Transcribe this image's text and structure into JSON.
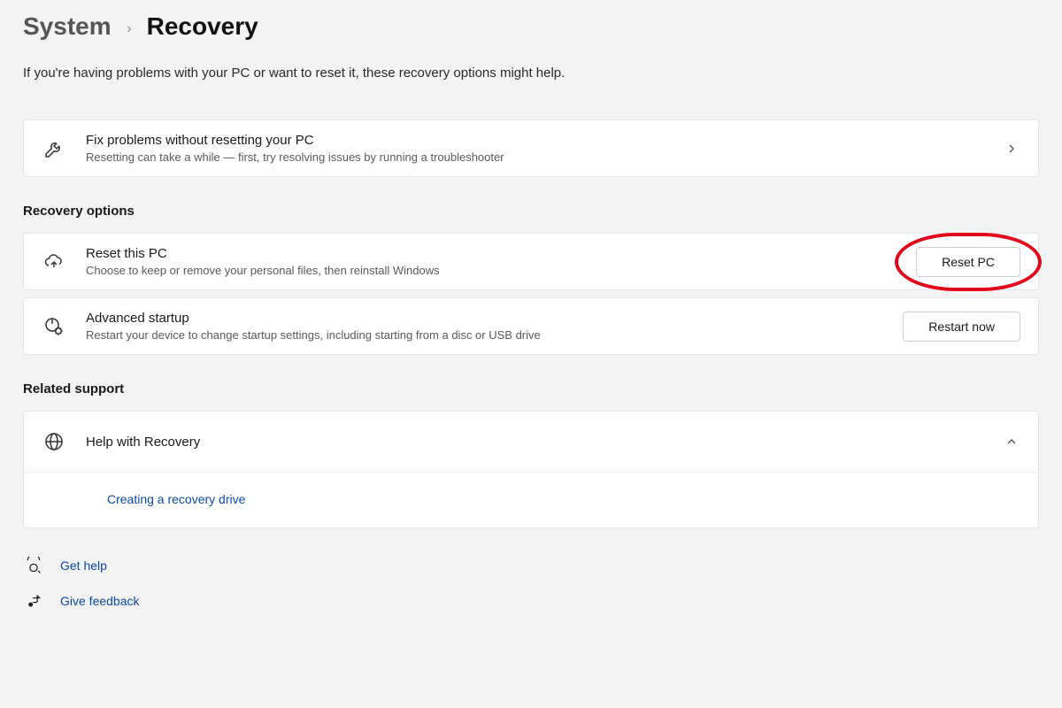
{
  "breadcrumb": {
    "parent": "System",
    "current": "Recovery"
  },
  "subtitle": "If you're having problems with your PC or want to reset it, these recovery options might help.",
  "fix_card": {
    "title": "Fix problems without resetting your PC",
    "desc": "Resetting can take a while — first, try resolving issues by running a troubleshooter"
  },
  "sections": {
    "recovery_options": "Recovery options",
    "related_support": "Related support"
  },
  "reset_card": {
    "title": "Reset this PC",
    "desc": "Choose to keep or remove your personal files, then reinstall Windows",
    "button": "Reset PC"
  },
  "advanced_card": {
    "title": "Advanced startup",
    "desc": "Restart your device to change startup settings, including starting from a disc or USB drive",
    "button": "Restart now"
  },
  "help_expander": {
    "title": "Help with Recovery",
    "link": "Creating a recovery drive"
  },
  "footer": {
    "get_help": "Get help",
    "feedback": "Give feedback"
  }
}
